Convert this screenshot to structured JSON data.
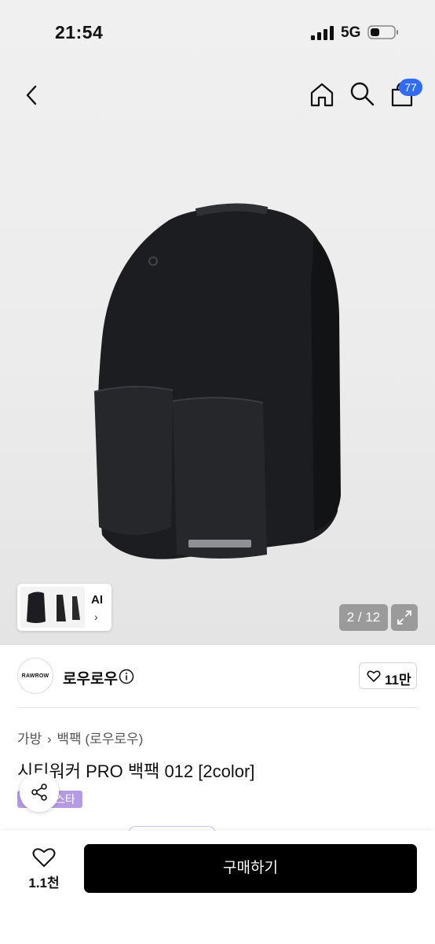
{
  "status_bar": {
    "time": "21:54",
    "network": "5G"
  },
  "nav": {
    "cart_count": "77"
  },
  "gallery": {
    "ai_label": "AI",
    "ai_chevron": "›",
    "counter": "2 / 12"
  },
  "seller": {
    "logo_text": "RAWROW",
    "name": "로우로우"
  },
  "like": {
    "count": "11만"
  },
  "breadcrumb": {
    "category": "가방",
    "separator": "›",
    "subcategory": "백팩 (로우로우)"
  },
  "product": {
    "title": "시티워커 PRO 백팩 012 [2color]",
    "tag_label": "스타"
  },
  "bottom_bar": {
    "wish_count": "1.1천",
    "buy_label": "구매하기"
  },
  "icons": {
    "back": "chevron-left-icon",
    "home": "home-icon",
    "search": "search-icon",
    "cart": "shopping-bag-icon",
    "expand": "expand-icon",
    "info": "info-icon",
    "heart": "heart-icon",
    "share": "share-icon"
  },
  "colors": {
    "cart_badge": "#2f6bff",
    "tag": "#b79ae6",
    "buy_button": "#000000"
  }
}
